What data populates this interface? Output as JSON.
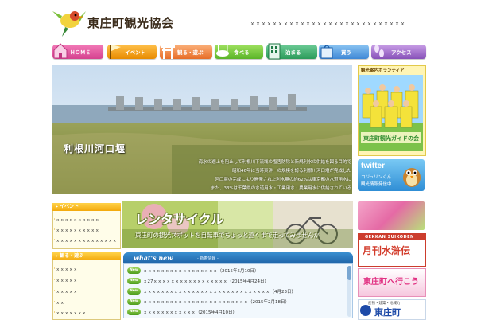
{
  "header": {
    "site_title": "東庄町観光協会",
    "tagline": "ｘｘｘｘｘｘｘｘｘｘｘｘｘｘｘｘｘｘｘｘｘｘｘｘｘｘｘｘ"
  },
  "nav": {
    "home": "ＨＯＭＥ",
    "event": "イベント",
    "see": "観る・遊ぶ",
    "eat": "食べる",
    "stay": "泊まる",
    "buy": "買う",
    "access": "アクセス"
  },
  "hero": {
    "caption": "利根川河口堰",
    "desc_lines": [
      "海水の遡上を阻止して利根川下流域の塩害防除と新規利水の供給を図る目的で",
      "昭和46年に当時東洋一の規模を誇る利根川河口堰が完成した",
      "河口堰の完成により開発された利水量の約62%は東京都の水道用水に",
      "また、33%は千葉県の水道用水・工業用水・農業用水に供給されている"
    ]
  },
  "volunteer": {
    "title": "観光案内ボランティア",
    "photo_text": "東庄町観光ガイドの会"
  },
  "twitter": {
    "word": "twitter",
    "sub1": "コジュリンくん",
    "sub2": "観光情報発信中"
  },
  "banners": {
    "suikoden_en": "GEKKAN SUIKODEN",
    "suikoden_jp": "月刊水滸伝",
    "goto": "東庄町へ行こう",
    "logo_top": "産物・建築・地域力",
    "logo_name": "東庄町"
  },
  "sidebar": {
    "event_head": "イベント",
    "event_items": [
      "ｘｘｘｘｘｘｘｘｘｘ",
      "ｘｘｘｘｘｘｘｘｘｘ",
      "ｘｘｘｘｘｘｘｘｘｘｘｘｘｘ"
    ],
    "see_head": "観る・遊ぶ",
    "see_items": [
      "ｘｘｘｘｘ",
      "ｘｘｘｘｘ",
      "ｘｘｘｘｘ",
      "ｘｘ",
      "ｘｘｘｘｘｘｘ"
    ]
  },
  "rental": {
    "title": "レンタサイクル",
    "sub": "東庄町の観光スポットを自転車でちょっと遠くまで走ってみませんか"
  },
  "news": {
    "title": "what's new",
    "subtitle": "- 新着情報 -",
    "badge": "New",
    "items": [
      "ｘｘｘｘｘｘｘｘｘｘｘｘｘｘｘｘｘ（2015年5月10日）",
      "ｘ27ｘｘｘｘｘｘｘｘｘｘｘｘｘｘｘｘｘ（2015年4月24日）",
      "ｘｘｘｘｘｘｘｘｘｘｘｘｘｘｘｘｘｘｘｘｘｘｘｘｘｘｘｘｘ（4月23日）",
      "ｘｘｘｘｘｘｘｘｘｘｘｘｘｘｘｘｘｘｘｘｘｘｘｘ（2015年2月18日）",
      "ｘｘｘｘｘｘｘｘｘｘｘｘ（2015年4月10日）"
    ]
  },
  "colors": {
    "nav_home": "#e45fa3",
    "nav_event": "#f4a21c",
    "nav_see": "#f08a48",
    "nav_eat": "#7cca40",
    "nav_stay": "#3bb06f",
    "nav_buy": "#5aa2e4",
    "nav_access": "#a06fcf",
    "news_header": "#2b78bd",
    "sidebar_head": "#f5b21a"
  }
}
